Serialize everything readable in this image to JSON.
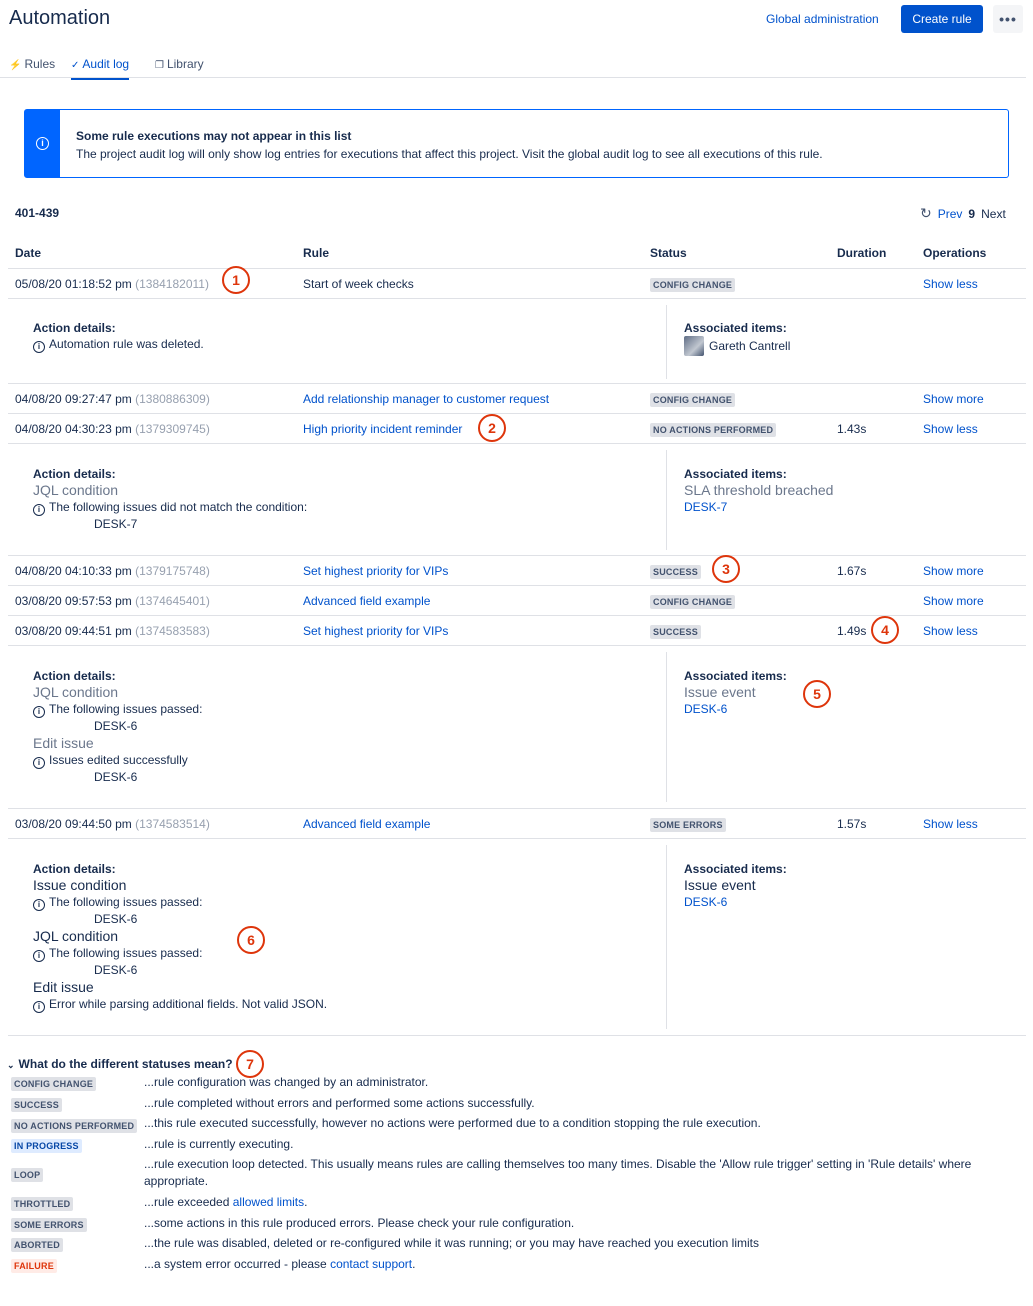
{
  "header": {
    "title": "Automation",
    "global_admin": "Global administration",
    "create_rule": "Create rule",
    "more": "•••"
  },
  "tabs": [
    {
      "label": "Rules",
      "icon": "lightning-icon"
    },
    {
      "label": "Audit log",
      "icon": "check-circle-icon"
    },
    {
      "label": "Library",
      "icon": "copy-icon"
    }
  ],
  "banner": {
    "title": "Some rule executions may not appear in this list",
    "text": "The project audit log will only show log entries for executions that affect this project. Visit the global audit log to see all executions of this rule."
  },
  "pager": {
    "range": "401-439",
    "prev": "Prev",
    "page": "9",
    "next": "Next"
  },
  "columns": {
    "date": "Date",
    "rule": "Rule",
    "status": "Status",
    "duration": "Duration",
    "operations": "Operations"
  },
  "rows": [
    {
      "date": "05/08/20 01:18:52 pm",
      "id": "(1384182011)",
      "rule": "Start of week checks",
      "status": "CONFIG CHANGE",
      "duration": "",
      "op": "Show less"
    },
    {
      "date": "04/08/20 09:27:47 pm",
      "id": "(1380886309)",
      "rule": "Add relationship manager to customer request",
      "status": "CONFIG CHANGE",
      "duration": "",
      "op": "Show more"
    },
    {
      "date": "04/08/20 04:30:23 pm",
      "id": "(1379309745)",
      "rule": "High priority incident reminder",
      "status": "NO ACTIONS PERFORMED",
      "duration": "1.43s",
      "op": "Show less"
    },
    {
      "date": "04/08/20 04:10:33 pm",
      "id": "(1379175748)",
      "rule": "Set highest priority for VIPs",
      "status": "SUCCESS",
      "duration": "1.67s",
      "op": "Show more"
    },
    {
      "date": "03/08/20 09:57:53 pm",
      "id": "(1374645401)",
      "rule": "Advanced field example",
      "status": "CONFIG CHANGE",
      "duration": "",
      "op": "Show more"
    },
    {
      "date": "03/08/20 09:44:51 pm",
      "id": "(1374583583)",
      "rule": "Set highest priority for VIPs",
      "status": "SUCCESS",
      "duration": "1.49s",
      "op": "Show less"
    },
    {
      "date": "03/08/20 09:44:50 pm",
      "id": "(1374583514)",
      "rule": "Advanced field example",
      "status": "SOME ERRORS",
      "duration": "1.57s",
      "op": "Show less"
    }
  ],
  "labels": {
    "action_details": "Action details:",
    "associated_items": "Associated items:"
  },
  "details": {
    "d1": {
      "msg": "Automation rule was deleted.",
      "person": "Gareth Cantrell"
    },
    "d2": {
      "head": "JQL condition",
      "msg": "The following issues did not match the condition:",
      "issue": "DESK-7",
      "assoc_head": "SLA threshold breached",
      "assoc_link": "DESK-7"
    },
    "d3": {
      "head1": "JQL condition",
      "msg1": "The following issues passed:",
      "issue1": "DESK-6",
      "head2": "Edit issue",
      "msg2": "Issues edited successfully",
      "issue2": "DESK-6",
      "assoc_head": "Issue event",
      "assoc_link": "DESK-6"
    },
    "d4": {
      "head1": "Issue condition",
      "msg1": "The following issues passed:",
      "issue1": "DESK-6",
      "head2": "JQL condition",
      "msg2": "The following issues passed:",
      "issue2": "DESK-6",
      "head3": "Edit issue",
      "msg3": "Error while parsing additional fields. Not valid JSON.",
      "assoc_head": "Issue event",
      "assoc_link": "DESK-6"
    }
  },
  "callouts": [
    "1",
    "2",
    "3",
    "4",
    "5",
    "6",
    "7"
  ],
  "legend": {
    "title": "What do the different statuses mean?",
    "items": [
      {
        "status": "CONFIG CHANGE",
        "text": "...rule configuration was changed by an administrator."
      },
      {
        "status": "SUCCESS",
        "text": "...rule completed without errors and performed some actions successfully."
      },
      {
        "status": "NO ACTIONS PERFORMED",
        "text": "...this rule executed successfully, however no actions were performed due to a condition stopping the rule execution."
      },
      {
        "status": "IN PROGRESS",
        "text": "...rule is currently executing."
      },
      {
        "status": "LOOP",
        "text": "...rule execution loop detected. This usually means rules are calling themselves too many times. Disable the 'Allow rule trigger' setting in 'Rule details' where appropriate."
      },
      {
        "status": "THROTTLED",
        "text": "...rule exceeded ",
        "link": "allowed limits",
        "after": "."
      },
      {
        "status": "SOME ERRORS",
        "text": "...some actions in this rule produced errors. Please check your rule configuration."
      },
      {
        "status": "ABORTED",
        "text": "...the rule was disabled, deleted or re-configured while it was running; or you may have reached you execution limits"
      },
      {
        "status": "FAILURE",
        "text": "...a system error occurred - please ",
        "link": "contact support",
        "after": "."
      }
    ]
  },
  "colors": {
    "primary": "#0052cc",
    "callout": "#de350b",
    "failure": "#de350b",
    "in_progress": "#0747a6"
  }
}
